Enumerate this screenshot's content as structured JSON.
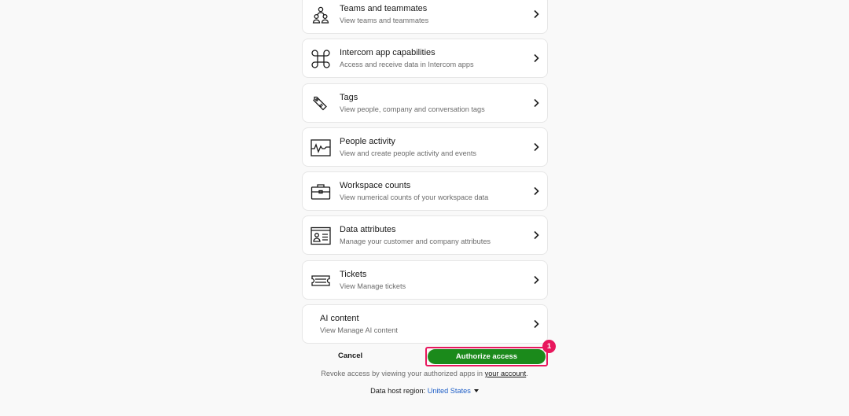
{
  "items": [
    {
      "title": "Teams and teammates",
      "desc": "View teams and teammates",
      "icon": "teams-icon"
    },
    {
      "title": "Intercom app capabilities",
      "desc": "Access and receive data in Intercom apps",
      "icon": "command-icon"
    },
    {
      "title": "Tags",
      "desc": "View people, company and conversation tags",
      "icon": "tag-icon"
    },
    {
      "title": "People activity",
      "desc": "View and create people activity and events",
      "icon": "activity-icon"
    },
    {
      "title": "Workspace counts",
      "desc": "View numerical counts of your workspace data",
      "icon": "briefcase-icon"
    },
    {
      "title": "Data attributes",
      "desc": "Manage your customer and company attributes",
      "icon": "id-card-icon"
    },
    {
      "title": "Tickets",
      "desc": "View Manage tickets",
      "icon": "ticket-icon"
    },
    {
      "title": "AI content",
      "desc": "View Manage AI content",
      "icon": ""
    }
  ],
  "actions": {
    "cancel_label": "Cancel",
    "authorize_label": "Authorize access",
    "badge": "1"
  },
  "revoke": {
    "prefix": "Revoke access by viewing your authorized apps in",
    "link": "your account",
    "suffix": "."
  },
  "region": {
    "label": "Data host region:",
    "value": "United States"
  },
  "colors": {
    "accent_green": "#1b8a1b",
    "highlight_pink": "#e8175d",
    "link_blue": "#1f5fc7"
  }
}
